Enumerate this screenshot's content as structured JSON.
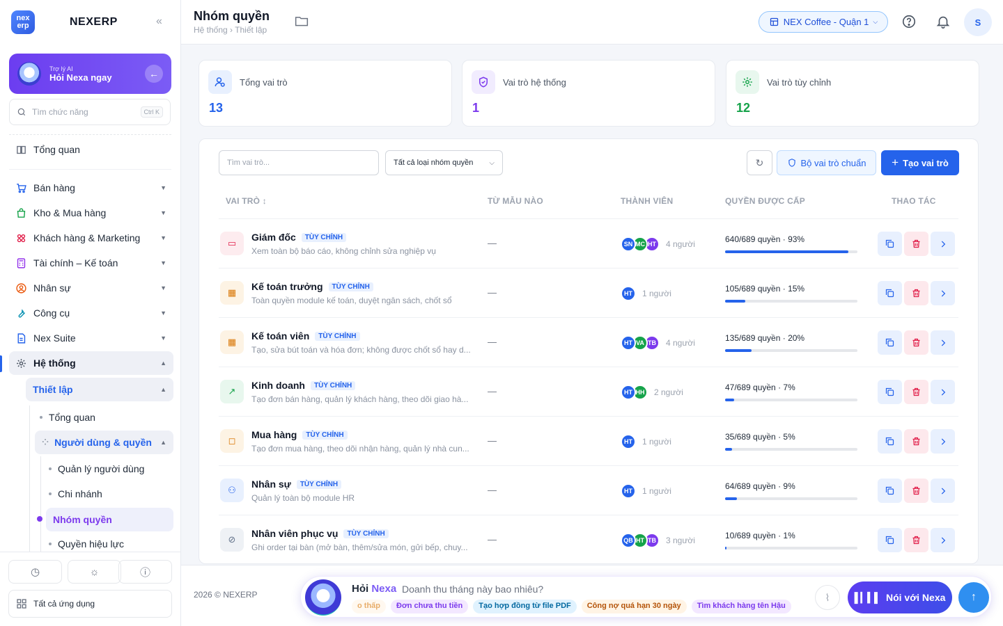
{
  "app": {
    "brand": "NEXERP",
    "logo_text": "nex erp"
  },
  "ai_card": {
    "small": "Trợ lý AI",
    "big": "Hỏi Nexa ngay"
  },
  "sidebar_search": {
    "placeholder": "Tìm chức năng",
    "shortcut": "Ctrl K"
  },
  "nav": {
    "overview": "Tổng quan",
    "items": [
      "Bán hàng",
      "Kho & Mua hàng",
      "Khách hàng & Marketing",
      "Tài chính – Kế toán",
      "Nhân sự",
      "Công cụ",
      "Nex Suite",
      "Hệ thống"
    ],
    "setup": "Thiết lập",
    "setup_children": {
      "overview": "Tổng quan",
      "users_perms": "Người dùng & quyền",
      "user_mgmt": "Quản lý người dùng",
      "branch": "Chi nhánh",
      "roles": "Nhóm quyền",
      "effective": "Quyền hiệu lực"
    },
    "all_apps": "Tất cả ứng dụng"
  },
  "header": {
    "title": "Nhóm quyền",
    "breadcrumb": "Hệ thống › Thiết lập",
    "branch": "NEX Coffee - Quận 1",
    "avatar": "S"
  },
  "stats": [
    {
      "label": "Tổng vai trò",
      "value": "13",
      "color": "#2563eb"
    },
    {
      "label": "Vai trò hệ thống",
      "value": "1",
      "color": "#7c3aed"
    },
    {
      "label": "Vai trò tùy chỉnh",
      "value": "12",
      "color": "#16a34a"
    }
  ],
  "toolbar": {
    "search_placeholder": "Tìm vai trò...",
    "filter": "Tất cả loại nhóm quyền",
    "preset": "Bộ vai trò chuẩn",
    "create": "Tạo vai trò"
  },
  "table": {
    "headers": [
      "VAI TRÒ ↕",
      "TỪ MẪU NÀO",
      "THÀNH VIÊN",
      "QUYỀN ĐƯỢC CẤP",
      "THAO TÁC"
    ],
    "rows": [
      {
        "name": "Giám đốc",
        "tag": "TÙY CHỈNH",
        "desc": "Xem toàn bộ báo cáo, không chỉnh sửa nghiệp vụ",
        "template": "—",
        "members": [
          "SN",
          "MC",
          "HT"
        ],
        "count": "4 người",
        "perm": "640/689 quyền · 93%",
        "pct": 93
      },
      {
        "name": "Kế toán trưởng",
        "tag": "TÙY CHỈNH",
        "desc": "Toàn quyền module kế toán, duyệt ngân sách, chốt sổ",
        "template": "—",
        "members": [
          "HT"
        ],
        "count": "1 người",
        "perm": "105/689 quyền · 15%",
        "pct": 15
      },
      {
        "name": "Kế toán viên",
        "tag": "TÙY CHỈNH",
        "desc": "Tạo, sửa bút toán và hóa đơn; không được chốt sổ hay d...",
        "template": "—",
        "members": [
          "HT",
          "VA",
          "TB"
        ],
        "count": "4 người",
        "perm": "135/689 quyền · 20%",
        "pct": 20
      },
      {
        "name": "Kinh doanh",
        "tag": "TÙY CHỈNH",
        "desc": "Tạo đơn bán hàng, quản lý khách hàng, theo dõi giao hà...",
        "template": "—",
        "members": [
          "HT",
          "HH"
        ],
        "count": "2 người",
        "perm": "47/689 quyền · 7%",
        "pct": 7
      },
      {
        "name": "Mua hàng",
        "tag": "TÙY CHỈNH",
        "desc": "Tạo đơn mua hàng, theo dõi nhận hàng, quản lý nhà cun...",
        "template": "—",
        "members": [
          "HT"
        ],
        "count": "1 người",
        "perm": "35/689 quyền · 5%",
        "pct": 5
      },
      {
        "name": "Nhân sự",
        "tag": "TÙY CHỈNH",
        "desc": "Quản lý toàn bộ module HR",
        "template": "—",
        "members": [
          "HT"
        ],
        "count": "1 người",
        "perm": "64/689 quyền · 9%",
        "pct": 9
      },
      {
        "name": "Nhân viên phục vụ",
        "tag": "TÙY CHỈNH",
        "desc": "Ghi order tại bàn (mở bàn, thêm/sửa món, gửi bếp, chuy...",
        "template": "—",
        "members": [
          "QB",
          "HT",
          "TB"
        ],
        "count": "3 người",
        "perm": "10/689 quyền · 1%",
        "pct": 1
      }
    ]
  },
  "footer": {
    "copyright": "2026 © NEXERP",
    "ask_prefix": "Hỏi",
    "ask_brand": "Nexa",
    "ask_placeholder": "Doanh thu tháng này bao nhiêu?",
    "chips": [
      "o thấp",
      "Đơn chưa thu tiền",
      "Tạo hợp đồng từ file PDF",
      "Công nợ quá hạn 30 ngày",
      "Tìm khách hàng tên Hậu"
    ],
    "talk": "Nói với Nexa"
  }
}
